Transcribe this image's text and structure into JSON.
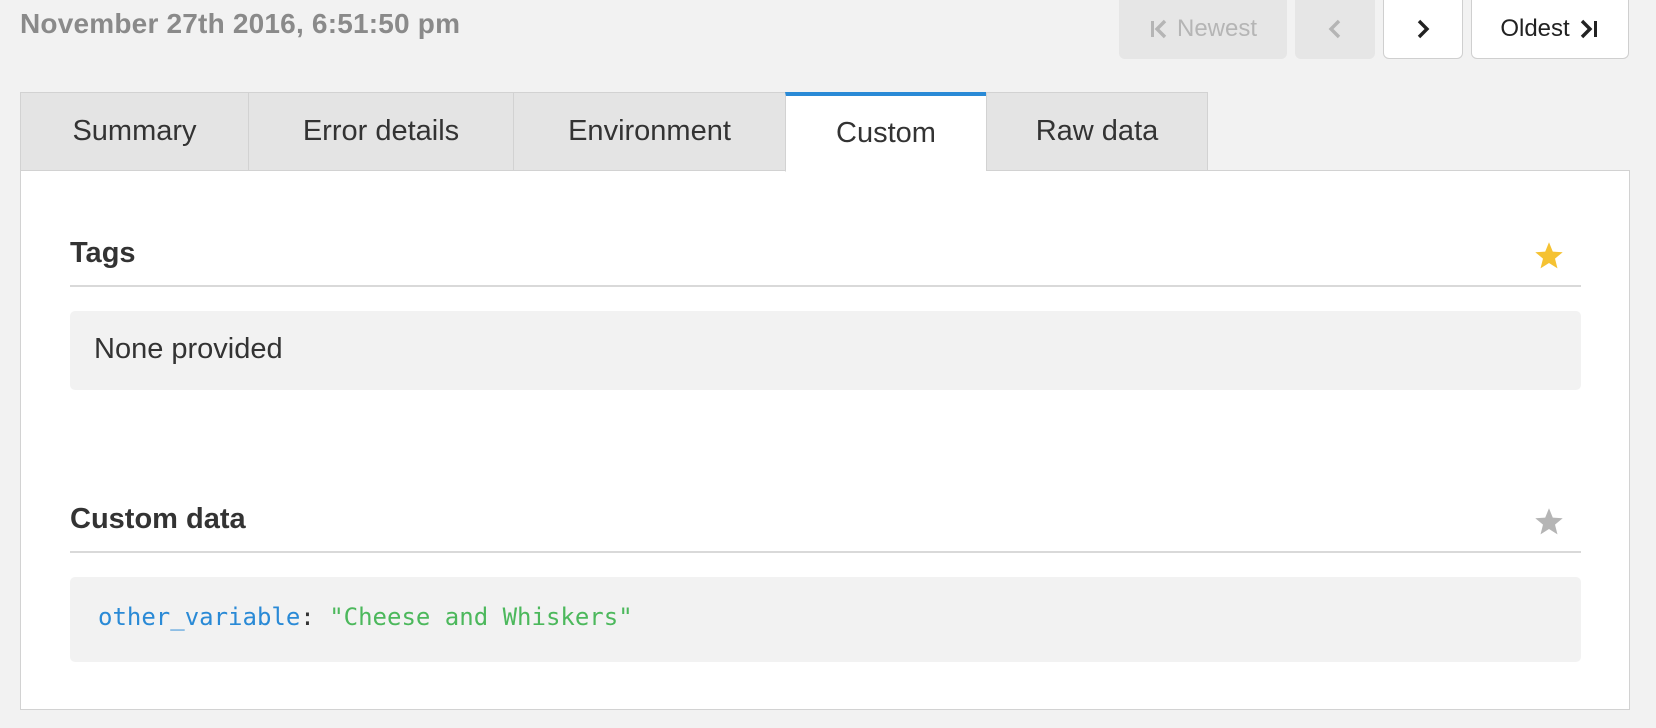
{
  "timestamp": "November 27th 2016, 6:51:50 pm",
  "nav": {
    "newest_label": "Newest",
    "oldest_label": "Oldest",
    "newest_disabled": true,
    "prev_disabled": true
  },
  "tabs": [
    {
      "label": "Summary",
      "active": false
    },
    {
      "label": "Error details",
      "active": false
    },
    {
      "label": "Environment",
      "active": false
    },
    {
      "label": "Custom",
      "active": true
    },
    {
      "label": "Raw data",
      "active": false
    }
  ],
  "sections": {
    "tags": {
      "title": "Tags",
      "empty_text": "None provided",
      "starred": true
    },
    "custom": {
      "title": "Custom data",
      "starred": false,
      "entries": [
        {
          "key": "other_variable",
          "value": "\"Cheese and Whiskers\""
        }
      ]
    }
  },
  "colors": {
    "accent": "#2a8ad6",
    "star_active": "#f5c232",
    "star_inactive": "#b5b5b5",
    "code_key": "#2a8ad6",
    "code_value": "#4cb85c"
  },
  "icons": {
    "newest": "skip-to-first-icon",
    "prev": "chevron-left-icon",
    "next": "chevron-right-icon",
    "oldest": "skip-to-last-icon",
    "star": "star-icon"
  }
}
